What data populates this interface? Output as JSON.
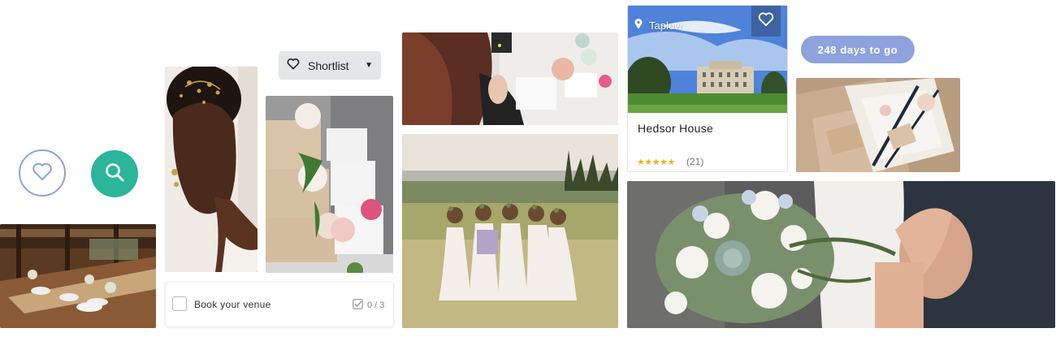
{
  "shortlist": {
    "label": "Shortlist"
  },
  "countdown": {
    "text": "248 days to go"
  },
  "venue": {
    "location": "Taplow",
    "name": "Hedsor House",
    "rating_stars": "★★★★★",
    "review_count": "(21)"
  },
  "task": {
    "label": "Book your venue",
    "progress": "0 / 3"
  },
  "colors": {
    "accent_blue": "#8ea2dd",
    "accent_green": "#2bb59a",
    "star": "#f3b01c"
  },
  "icons": [
    "heart-icon",
    "search-icon",
    "chevron-down-icon",
    "location-pin-icon",
    "checkbox-icon"
  ]
}
